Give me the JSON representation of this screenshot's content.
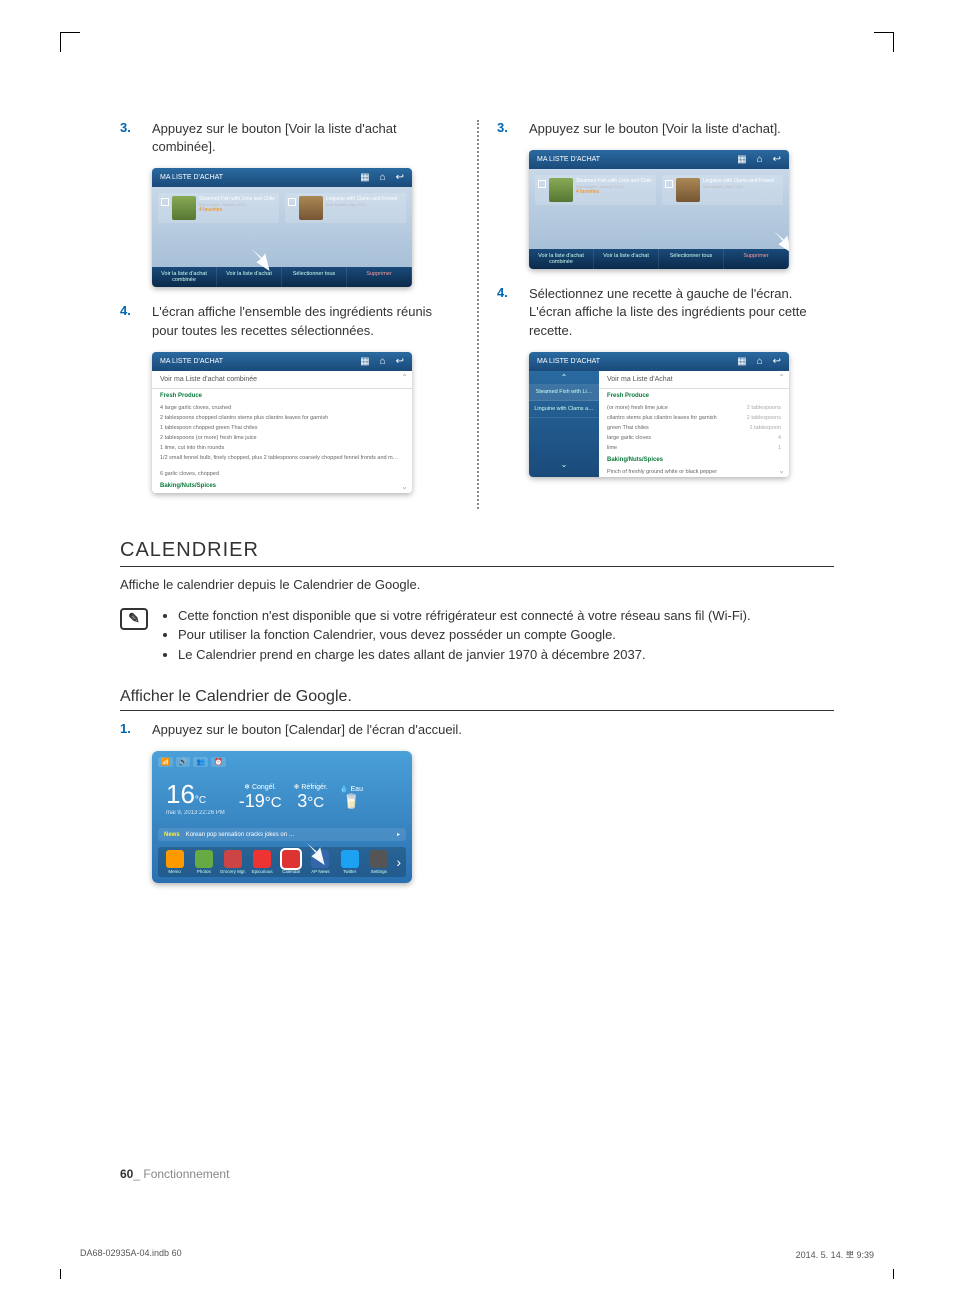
{
  "left": {
    "step3_num": "3.",
    "step3_text": "Appuyez sur le bouton [Voir la liste d'achat combinée].",
    "step4_num": "4.",
    "step4_text": "L'écran affiche l'ensemble des ingrédients réunis pour toutes les recettes sélectionnées."
  },
  "right": {
    "step3_num": "3.",
    "step3_text": "Appuyez sur le bouton [Voir la liste d'achat].",
    "step4_num": "4.",
    "step4_text": "Sélectionnez une recette à gauche de l'écran. L'écran affiche la liste des ingrédients pour cette recette."
  },
  "ss1": {
    "title": "MA LISTE D'ACHAT",
    "card1_title": "Steamed Fish with Lime and Chile",
    "card1_sub": "Bon Appétit, January 2013",
    "card1_meta": "4 favorites",
    "card2_title": "Linguine with Clams and Fennel",
    "card2_sub": "Bon Appétit, May 2012",
    "btn1": "Voir la liste d'achat combinée",
    "btn2": "Voir la liste d'achat",
    "btn3": "Sélectionner tous",
    "btn4": "Supprimer"
  },
  "ss2": {
    "title": "MA LISTE D'ACHAT",
    "heading": "Voir ma Liste d'achat combinée",
    "cat1": "Fresh Produce",
    "i1": "4 large garlic cloves, crushed",
    "i2": "2 tablespoons chopped cilantro stems plus cilantro leaves for garnish",
    "i3": "1 tablespoon chopped green Thai chiles",
    "i4": "2 tablespoons (or more) fresh lime juice",
    "i5": "1 lime, cut into thin rounds",
    "i6": "1/2 small fennel bulb, finely chopped, plus 2 tablespoons coarsely chopped fennel fronds and m…",
    "i7": "6 garlic cloves, chopped",
    "cat2": "Baking/Nuts/Spices"
  },
  "ss3": {
    "title": "MA LISTE D'ACHAT",
    "heading": "Voir ma Liste d'Achat",
    "side1": "Steamed Fish with Li…",
    "side2": "Linguine with Clams a…",
    "cat1": "Fresh Produce",
    "r1": "(or more) fresh lime juice",
    "q1": "2",
    "u1": "tablespoons",
    "r2": "cilantro stems plus cilantro leaves for garnish",
    "q2": "2",
    "u2": "tablespoons",
    "r3": "green Thai chiles",
    "q3": "1",
    "u3": "tablespoon",
    "r4": "large garlic cloves",
    "q4": "4",
    "u4": "",
    "r5": "lime",
    "q5": "1",
    "u5": "",
    "cat2": "Baking/Nuts/Spices",
    "r6": "Pinch of freshly ground white or black pepper"
  },
  "calendar": {
    "heading": "CALENDRIER",
    "desc": "Affiche le calendrier depuis le Calendrier de Google.",
    "note1": "Cette fonction n'est disponible que si votre réfrigérateur est connecté à votre réseau sans fil (Wi-Fi).",
    "note2": "Pour utiliser la fonction Calendrier, vous devez posséder un compte Google.",
    "note3": "Le Calendrier prend en charge les dates allant de janvier 1970 à décembre 2037.",
    "sub": "Afficher le Calendrier de Google.",
    "step1_num": "1.",
    "step1_text": "Appuyez sur le bouton [Calendar] de l'écran d'accueil."
  },
  "home": {
    "temp": "16",
    "temp_unit": "°C",
    "date": "mai 9, 2013 22:26 PM",
    "l1": "Congél.",
    "v1": "-19",
    "u1": "°C",
    "l2": "Réfrigér.",
    "v2": "3",
    "u2": "°C",
    "l3": "Eau",
    "news_lbl": "News",
    "news_txt": "Korean pop sensation cracks jokes on …",
    "apps": [
      "Memo",
      "Photos",
      "Grocery Mgr.",
      "Epicurious",
      "Calendar",
      "AP News",
      "Twitter",
      "Settings"
    ]
  },
  "footer": {
    "page": "60",
    "section": "_ Fonctionnement"
  },
  "print": {
    "left": "DA68-02935A-04.indb   60",
    "right": "2014. 5. 14.   뽀 9:39"
  }
}
